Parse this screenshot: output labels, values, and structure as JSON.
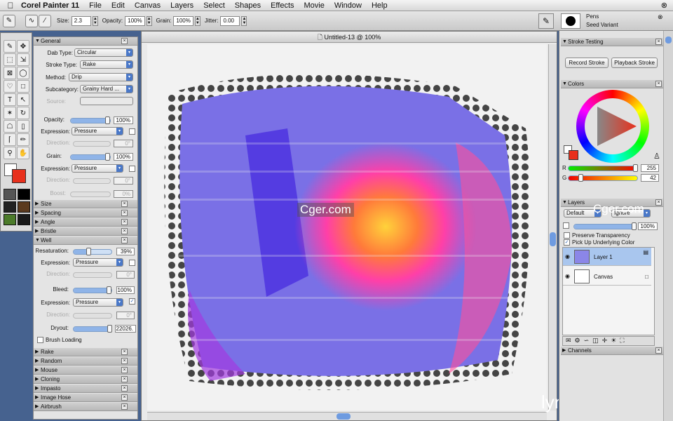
{
  "menubar": {
    "app_name": "Corel Painter 11",
    "items": [
      "File",
      "Edit",
      "Canvas",
      "Layers",
      "Select",
      "Shapes",
      "Effects",
      "Movie",
      "Window",
      "Help"
    ]
  },
  "propbar": {
    "size_label": "Size:",
    "size_value": "2.3",
    "opacity_label": "Opacity:",
    "opacity_value": "100%",
    "grain_label": "Grain:",
    "grain_value": "100%",
    "jitter_label": "Jitter:",
    "jitter_value": "0.00",
    "brush_category": "Pens",
    "brush_variant": "Seed Variant"
  },
  "brush_controls": {
    "general": {
      "title": "General",
      "dab_type_label": "Dab Type:",
      "dab_type": "Circular",
      "stroke_type_label": "Stroke Type:",
      "stroke_type": "Rake",
      "method_label": "Method:",
      "method": "Drip",
      "subcategory_label": "Subcategory:",
      "subcategory": "Grainy Hard ...",
      "source_label": "Source:",
      "opacity_label": "Opacity:",
      "opacity_value": "100%",
      "opacity_level": 1.0,
      "expression_label": "Expression:",
      "opacity_expression": "Pressure",
      "direction_label": "Direction:",
      "opacity_direction": "0°",
      "grain_label": "Grain:",
      "grain_value": "100%",
      "grain_level": 1.0,
      "grain_expression": "Pressure",
      "grain_direction": "0°",
      "boost_label": "Boost:",
      "boost_value": "0%"
    },
    "collapsed_top": [
      "Size",
      "Spacing",
      "Angle",
      "Bristle"
    ],
    "well": {
      "title": "Well",
      "resaturation_label": "Resaturation:",
      "resaturation_value": "39%",
      "resaturation_level": 0.39,
      "expression_label": "Expression:",
      "res_expression": "Pressure",
      "direction_label": "Direction:",
      "res_direction": "0°",
      "bleed_label": "Bleed:",
      "bleed_value": "100%",
      "bleed_level": 1.0,
      "bleed_expression": "Pressure",
      "bleed_direction": "0°",
      "dryout_label": "Dryout:",
      "dryout_value": "22026.",
      "brush_loading_label": "Brush Loading"
    },
    "collapsed_bottom": [
      "Rake",
      "Random",
      "Mouse",
      "Cloning",
      "Impasto",
      "Image Hose",
      "Airbrush"
    ]
  },
  "document": {
    "title": "Untitled-13 @ 100%"
  },
  "stroke_testing": {
    "title": "Stroke Testing",
    "record_label": "Record Stroke",
    "playback_label": "Playback Stroke"
  },
  "colors": {
    "title": "Colors",
    "r_label": "R",
    "r_value": "255",
    "g_label": "G",
    "g_value": "42",
    "main_color": "#e8301c",
    "secondary_color": "#ffffff"
  },
  "layers": {
    "title": "Layers",
    "composite_method": "Default",
    "composite_depth": "Ignore",
    "opacity_value": "100%",
    "preserve_transparency_label": "Preserve Transparency",
    "pick_up_label": "Pick Up Underlying Color",
    "items": [
      {
        "name": "Layer 1",
        "selected": true
      },
      {
        "name": "Canvas",
        "selected": false
      }
    ]
  },
  "channels": {
    "title": "Channels"
  },
  "watermarks": {
    "cger1": "Cger.com",
    "cger2": "Cger.com",
    "lynda": "lynda.com"
  }
}
